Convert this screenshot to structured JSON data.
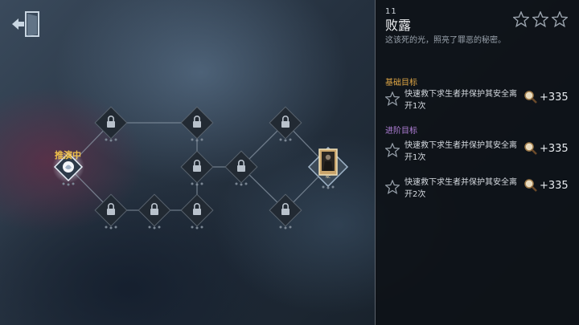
{
  "header": {
    "back_icon": "exit-door-icon"
  },
  "map": {
    "current_node_label": "推演中",
    "final_node_badge": "NC",
    "lock_icon": "lock-icon"
  },
  "panel": {
    "chapter_number": "11",
    "title": "败露",
    "subtitle": "这该死的光，照亮了罪恶的秘密。",
    "rating_stars": 3,
    "rating_earned": 0,
    "basic_section_label": "基础目标",
    "advanced_section_label": "进阶目标",
    "basic_goals": [
      {
        "text": "快速救下求生者并保护其安全离开1次",
        "reward": "+335",
        "reward_icon": "magnifier-icon"
      }
    ],
    "advanced_goals": [
      {
        "text": "快速救下求生者并保护其安全离开1次",
        "reward": "+335",
        "reward_icon": "magnifier-icon"
      },
      {
        "text": "快速救下求生者并保护其安全离开2次",
        "reward": "+335",
        "reward_icon": "magnifier-icon"
      }
    ]
  },
  "colors": {
    "accent_gold": "#e0a745",
    "accent_purple": "#b07fd8",
    "current_label": "#f0c04a"
  }
}
